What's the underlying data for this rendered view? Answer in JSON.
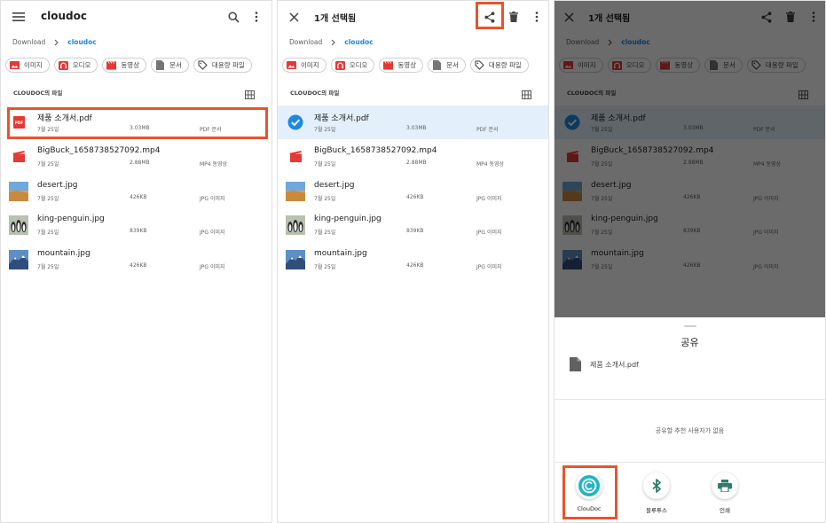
{
  "colors": {
    "accent": "#1e88e5",
    "highlight": "#e8542e",
    "selected_row": "#e3f0fb",
    "pdf_red": "#e53935",
    "cloudoc_teal": "#1fb6c4",
    "bluetooth_green": "#2e7d6e"
  },
  "app_title": "cloudoc",
  "selection_title": "1개 선택됨",
  "breadcrumb": {
    "parent": "Download",
    "current": "cloudoc"
  },
  "chips": [
    {
      "icon": "image-icon",
      "label": "이미지"
    },
    {
      "icon": "audio-icon",
      "label": "오디오"
    },
    {
      "icon": "video-icon",
      "label": "동영상"
    },
    {
      "icon": "document-icon",
      "label": "문서"
    },
    {
      "icon": "tag-icon",
      "label": "대용량 파일"
    }
  ],
  "section_title": "CLOUDOC의 파일",
  "files": [
    {
      "name": "제품 소개서.pdf",
      "date": "7월 25일",
      "size": "3.03MB",
      "kind": "PDF 문서",
      "thumb": "pdf"
    },
    {
      "name": "BigBuck_1658738527092.mp4",
      "date": "7월 25일",
      "size": "2.88MB",
      "kind": "MP4 동영상",
      "thumb": "video"
    },
    {
      "name": "desert.jpg",
      "date": "7월 25일",
      "size": "426KB",
      "kind": "JPG 이미지",
      "thumb": "desert"
    },
    {
      "name": "king-penguin.jpg",
      "date": "7월 25일",
      "size": "839KB",
      "kind": "JPG 이미지",
      "thumb": "penguin"
    },
    {
      "name": "mountain.jpg",
      "date": "7월 25일",
      "size": "426KB",
      "kind": "JPG 이미지",
      "thumb": "mountain"
    }
  ],
  "share_sheet": {
    "title": "공유",
    "file_name": "제품 소개서.pdf",
    "no_suggestions": "공유할 추천 사용자가 없음",
    "targets": [
      {
        "icon": "cloudoc-icon",
        "label": "ClouDoc"
      },
      {
        "icon": "bluetooth-icon",
        "label": "블루투스"
      },
      {
        "icon": "print-icon",
        "label": "인쇄"
      }
    ]
  }
}
